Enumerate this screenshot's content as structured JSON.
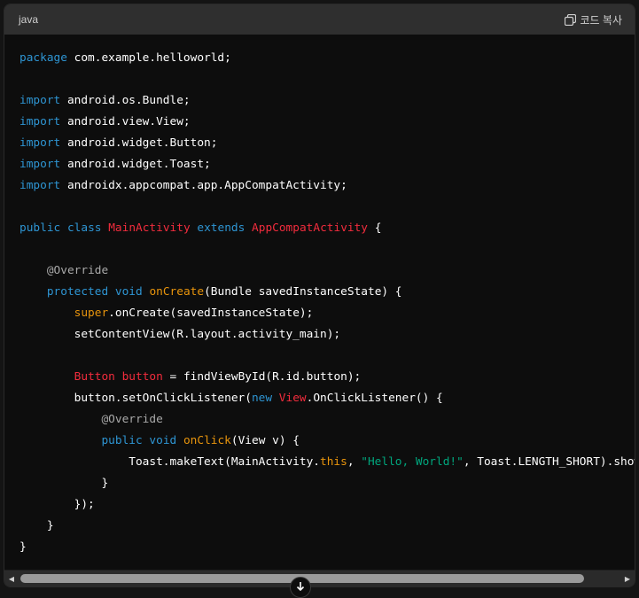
{
  "header": {
    "language": "java",
    "copy_label": "코드 복사"
  },
  "code_lines": [
    [
      {
        "t": "package",
        "c": "kw"
      },
      {
        "t": " com.example.helloworld;"
      }
    ],
    [],
    [
      {
        "t": "import",
        "c": "kw"
      },
      {
        "t": " android.os.Bundle;"
      }
    ],
    [
      {
        "t": "import",
        "c": "kw"
      },
      {
        "t": " android.view.View;"
      }
    ],
    [
      {
        "t": "import",
        "c": "kw"
      },
      {
        "t": " android.widget.Button;"
      }
    ],
    [
      {
        "t": "import",
        "c": "kw"
      },
      {
        "t": " android.widget.Toast;"
      }
    ],
    [
      {
        "t": "import",
        "c": "kw"
      },
      {
        "t": " androidx.appcompat.app.AppCompatActivity;"
      }
    ],
    [],
    [
      {
        "t": "public",
        "c": "kw"
      },
      {
        "t": " "
      },
      {
        "t": "class",
        "c": "kw"
      },
      {
        "t": " "
      },
      {
        "t": "MainActivity",
        "c": "cls"
      },
      {
        "t": " "
      },
      {
        "t": "extends",
        "c": "kw"
      },
      {
        "t": " "
      },
      {
        "t": "AppCompatActivity",
        "c": "cls"
      },
      {
        "t": " {"
      }
    ],
    [],
    [
      {
        "t": "    "
      },
      {
        "t": "@Override",
        "c": "ann"
      }
    ],
    [
      {
        "t": "    "
      },
      {
        "t": "protected",
        "c": "kw"
      },
      {
        "t": " "
      },
      {
        "t": "void",
        "c": "kw"
      },
      {
        "t": " "
      },
      {
        "t": "onCreate",
        "c": "sp"
      },
      {
        "t": "(Bundle savedInstanceState) {"
      }
    ],
    [
      {
        "t": "        "
      },
      {
        "t": "super",
        "c": "sp"
      },
      {
        "t": ".onCreate(savedInstanceState);"
      }
    ],
    [
      {
        "t": "        setContentView(R.layout.activity_main);"
      }
    ],
    [],
    [
      {
        "t": "        "
      },
      {
        "t": "Button",
        "c": "cls"
      },
      {
        "t": " "
      },
      {
        "t": "button",
        "c": "cls"
      },
      {
        "t": " = findViewById(R.id.button);"
      }
    ],
    [
      {
        "t": "        button.setOnClickListener("
      },
      {
        "t": "new",
        "c": "kw"
      },
      {
        "t": " "
      },
      {
        "t": "View",
        "c": "cls"
      },
      {
        "t": ".OnClickListener() {"
      }
    ],
    [
      {
        "t": "            "
      },
      {
        "t": "@Override",
        "c": "ann"
      }
    ],
    [
      {
        "t": "            "
      },
      {
        "t": "public",
        "c": "kw"
      },
      {
        "t": " "
      },
      {
        "t": "void",
        "c": "kw"
      },
      {
        "t": " "
      },
      {
        "t": "onClick",
        "c": "sp"
      },
      {
        "t": "(View v) {"
      }
    ],
    [
      {
        "t": "                Toast.makeText(MainActivity."
      },
      {
        "t": "this",
        "c": "sp"
      },
      {
        "t": ", "
      },
      {
        "t": "\"Hello, World!\"",
        "c": "str"
      },
      {
        "t": ", Toast.LENGTH_SHORT).show();"
      }
    ],
    [
      {
        "t": "            }"
      }
    ],
    [
      {
        "t": "        });"
      }
    ],
    [
      {
        "t": "    }"
      }
    ],
    [
      {
        "t": "}"
      }
    ]
  ],
  "colors": {
    "keyword": "#2e95d3",
    "class_name": "#f22c3d",
    "method": "#e9950c",
    "annotation": "#a9a9a9",
    "string": "#00a67d",
    "background": "#0d0d0d",
    "header": "#2f2f2f"
  },
  "icons": {
    "copy": "copy-icon",
    "scroll_left": "chevron-left-icon",
    "scroll_right": "chevron-right-icon",
    "scroll_down": "arrow-down-icon"
  }
}
